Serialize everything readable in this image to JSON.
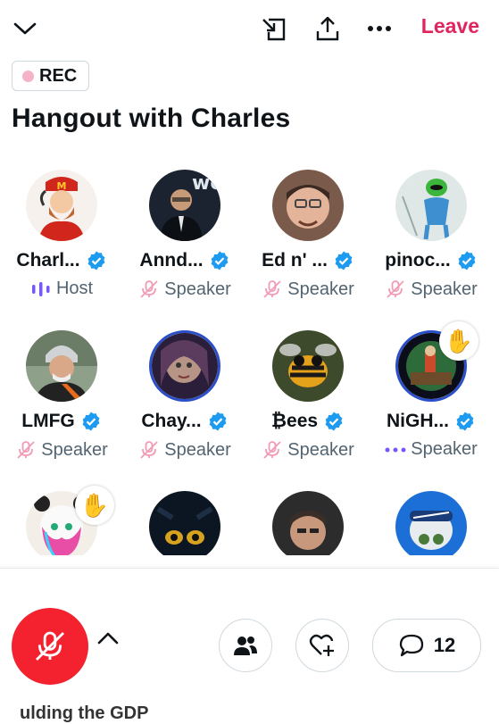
{
  "header": {
    "leave_label": "Leave"
  },
  "rec_label": "REC",
  "space_title": "Hangout with Charles",
  "colors": {
    "accent_red": "#f4212e",
    "leave_red": "#e0245e",
    "verified_blue": "#1d9bf0",
    "muted_pink": "#f29bb5",
    "host_purple": "#7856ff"
  },
  "participants": [
    {
      "name": "Charl...",
      "role": "Host",
      "role_icon": "audio-bars-icon",
      "verified": true
    },
    {
      "name": "Annd...",
      "role": "Speaker",
      "role_icon": "mic-muted-icon",
      "verified": true
    },
    {
      "name": "Ed n' ...",
      "role": "Speaker",
      "role_icon": "mic-muted-icon",
      "verified": true
    },
    {
      "name": "pinoc...",
      "role": "Speaker",
      "role_icon": "mic-muted-icon",
      "verified": true
    },
    {
      "name": "LMFG",
      "role": "Speaker",
      "role_icon": "mic-muted-icon",
      "verified": true
    },
    {
      "name": "Chay...",
      "role": "Speaker",
      "role_icon": "mic-muted-icon",
      "verified": true
    },
    {
      "name": "₿ees",
      "role": "Speaker",
      "role_icon": "mic-muted-icon",
      "verified": true
    },
    {
      "name": "NiGH...",
      "role": "Speaker",
      "role_icon": "dots-icon",
      "verified": true,
      "hand_raised": true
    },
    {
      "name": "",
      "role": "",
      "hand_raised": true
    },
    {
      "name": "",
      "role": ""
    },
    {
      "name": "",
      "role": ""
    },
    {
      "name": "",
      "role": ""
    }
  ],
  "controls": {
    "comments_count": "12"
  },
  "footer_partial_text": "ulding the GDP"
}
